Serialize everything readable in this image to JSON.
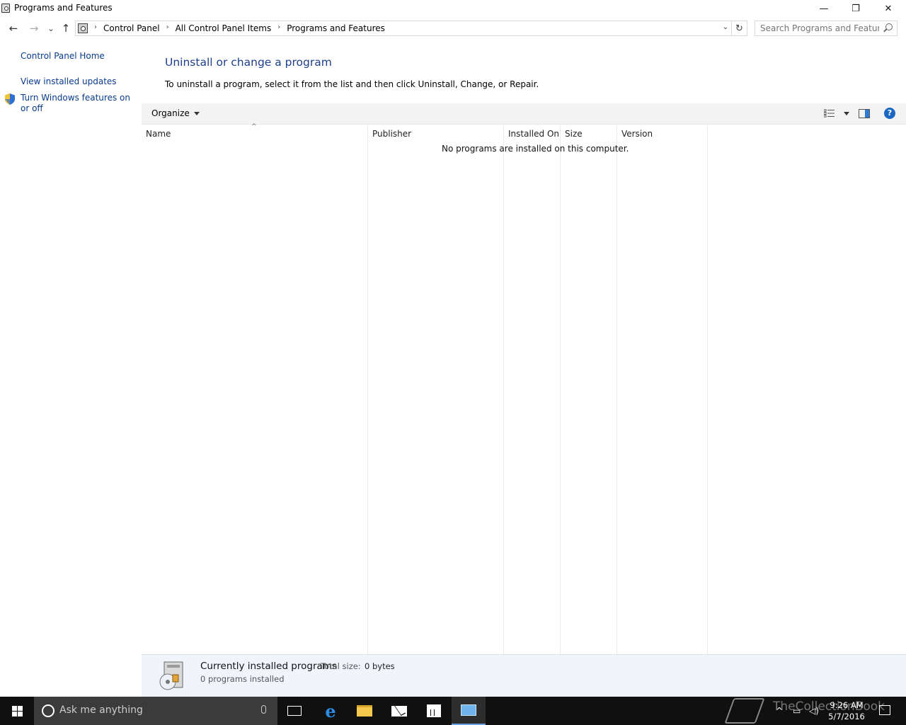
{
  "window": {
    "title": "Programs and Features",
    "minimize": "—",
    "maximize": "❐",
    "close": "✕"
  },
  "nav": {
    "back": "←",
    "forward": "→",
    "recent": "⌄",
    "up": "↑",
    "breadcrumbs": [
      "Control Panel",
      "All Control Panel Items",
      "Programs and Features"
    ],
    "separator": "›",
    "dropdown": "⌄",
    "refresh": "↻",
    "search_placeholder": "Search Programs and Features"
  },
  "sidebar": {
    "home": "Control Panel Home",
    "updates": "View installed updates",
    "features": "Turn Windows features on or off"
  },
  "main": {
    "title": "Uninstall or change a program",
    "description": "To uninstall a program, select it from the list and then click Uninstall, Change, or Repair.",
    "toolbar": {
      "organize": "Organize",
      "help": "?"
    },
    "columns": [
      "Name",
      "Publisher",
      "Installed On",
      "Size",
      "Version"
    ],
    "sort_indicator": "^",
    "empty_message": "No programs are installed on this computer."
  },
  "details": {
    "title": "Currently installed programs",
    "total_size_label": "Total size:",
    "total_size_value": "0 bytes",
    "count": "0 programs installed"
  },
  "taskbar": {
    "search_placeholder": "Ask me anything",
    "time": "9:26 AM",
    "date": "5/7/2016",
    "watermark": "TheCollectionBook",
    "accent": "#6aa0e0"
  },
  "colors": {
    "link": "#0a3b8c",
    "heading": "#1e3f8a",
    "details_bg": "#f1f5fb",
    "taskbar_bg": "#101010"
  }
}
